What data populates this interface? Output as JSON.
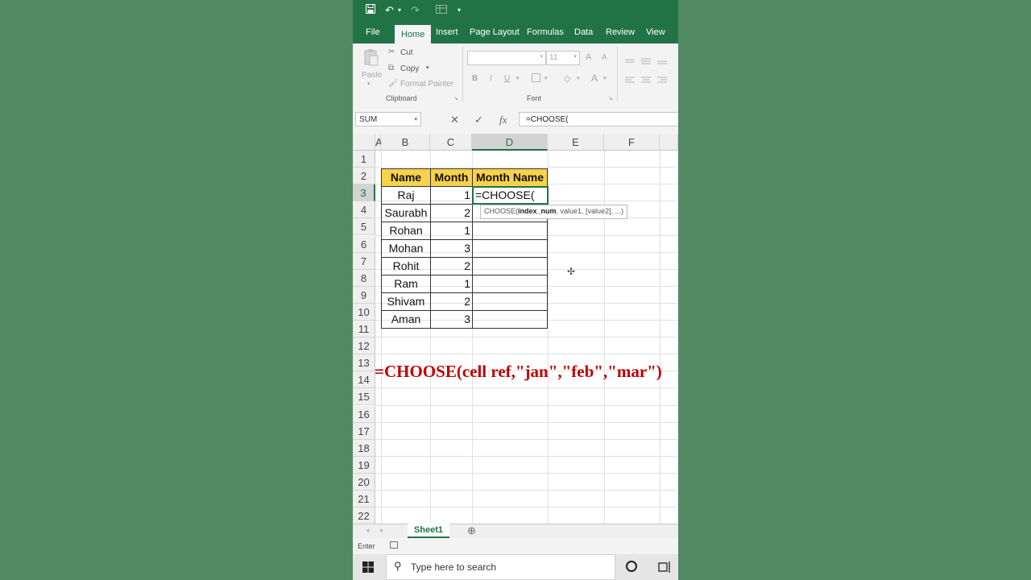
{
  "quick_access": {
    "save": "💾",
    "undo": "↶",
    "redo": "↷",
    "more": "▾"
  },
  "ribbon_tabs": [
    "File",
    "Home",
    "Insert",
    "Page Layout",
    "Formulas",
    "Data",
    "Review",
    "View"
  ],
  "active_tab": "Home",
  "clipboard": {
    "paste": "Paste",
    "cut": "Cut",
    "copy": "Copy",
    "format_painter": "Format Painter",
    "group": "Clipboard"
  },
  "font": {
    "size": "11",
    "grow": "A",
    "shrink": "A",
    "bold": "B",
    "italic": "I",
    "underline": "U",
    "color": "A",
    "group": "Font"
  },
  "formula_bar": {
    "name_box": "SUM",
    "cancel": "✕",
    "enter": "✓",
    "fx": "fx",
    "value": "=CHOOSE("
  },
  "columns": [
    "A",
    "B",
    "C",
    "D",
    "E",
    "F"
  ],
  "rows": [
    "1",
    "2",
    "3",
    "4",
    "5",
    "6",
    "7",
    "8",
    "9",
    "10",
    "11",
    "12",
    "13",
    "14",
    "15",
    "16",
    "17",
    "18",
    "19",
    "20",
    "21",
    "22"
  ],
  "table": {
    "headers": [
      "Name",
      "Month",
      "Month Name"
    ],
    "rows": [
      {
        "name": "Raj",
        "month": "1"
      },
      {
        "name": "Saurabh",
        "month": "2"
      },
      {
        "name": "Rohan",
        "month": "1"
      },
      {
        "name": "Mohan",
        "month": "3"
      },
      {
        "name": "Rohit",
        "month": "2"
      },
      {
        "name": "Ram",
        "month": "1"
      },
      {
        "name": "Shivam",
        "month": "2"
      },
      {
        "name": "Aman",
        "month": "3"
      }
    ],
    "active_cell_text": "=CHOOSE("
  },
  "tooltip": {
    "fn": "CHOOSE(",
    "arg_bold": "index_num",
    "rest": ", value1, [value2], ...)"
  },
  "annotation": "=CHOOSE(cell ref,\"jan\",\"feb\",\"mar\")",
  "sheet_tab": "Sheet1",
  "add_sheet": "⊕",
  "status": {
    "mode": "Enter"
  },
  "taskbar": {
    "search_placeholder": "Type here to search"
  },
  "colors": {
    "excel_green": "#217346",
    "header_fill": "#f8d24a",
    "annotation_red": "#c00000",
    "background": "#518a62"
  }
}
